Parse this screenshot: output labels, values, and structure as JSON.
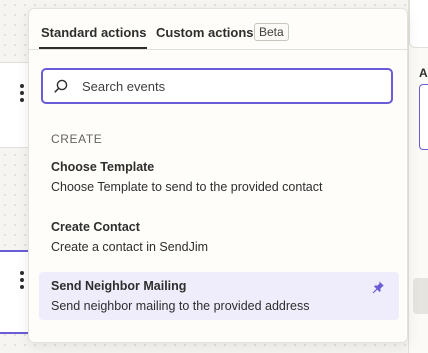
{
  "tabs": [
    {
      "label": "Standard actions",
      "active": true
    },
    {
      "label": "Custom actions",
      "active": false
    }
  ],
  "beta_badge": "Beta",
  "search": {
    "placeholder": "Search events",
    "value": ""
  },
  "section_header": "CREATE",
  "actions": [
    {
      "title": "Choose Template",
      "description": "Choose Template to send to the provided contact",
      "selected": false
    },
    {
      "title": "Create Contact",
      "description": "Create a contact in SendJim",
      "selected": false
    },
    {
      "title": "Send Neighbor Mailing",
      "description": "Send neighbor mailing to the provided address",
      "selected": true,
      "pinned": true
    }
  ],
  "right_panel": {
    "label_fragment": "Ac"
  },
  "icons": {
    "search": "search-icon",
    "pin": "pin-icon",
    "kebab": "kebab-menu-icon"
  },
  "colors": {
    "accent": "#6a5cd6",
    "selected_bg": "#efedfb",
    "text": "#2d2e2e"
  }
}
